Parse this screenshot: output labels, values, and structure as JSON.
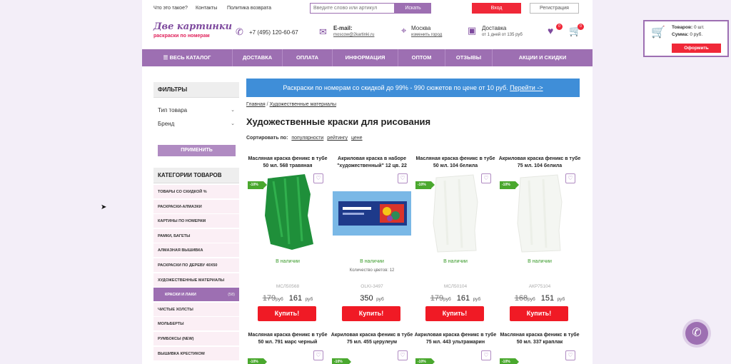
{
  "topbar": {
    "links": [
      "Что это такое?",
      "Контакты",
      "Политика возврата"
    ],
    "search_placeholder": "Введите слово или артикул",
    "search_button": "Искать",
    "login": "Вход",
    "register": "Регистрация"
  },
  "header": {
    "logo_title": "Две картинки",
    "logo_sub": "раскраски по номерам",
    "phone": "+7 (495) 120-60-67",
    "email_label": "E-mail:",
    "email": "moscow@2kartinki.ru",
    "city": "Москва",
    "city_change": "изменить город",
    "delivery_label": "Доставка",
    "delivery_text": "от 1 дней от 135 руб",
    "wishlist_count": "0",
    "cart_count": "0"
  },
  "nav": [
    "ВЕСЬ КАТАЛОГ",
    "ДОСТАВКА",
    "ОПЛАТА",
    "ИНФОРМАЦИЯ",
    "ОПТОМ",
    "ОТЗЫВЫ",
    "АКЦИИ И СКИДКИ"
  ],
  "sidebar": {
    "filters_title": "ФИЛЬТРЫ",
    "filters": [
      "Тип товара",
      "Бренд"
    ],
    "apply": "ПРИМЕНИТЬ",
    "categories_title": "КАТЕГОРИИ ТОВАРОВ",
    "categories": [
      {
        "label": "ТОВАРЫ СО СКИДКОЙ %"
      },
      {
        "label": "РАСКРАСКИ-АЛМАЗКИ"
      },
      {
        "label": "КАРТИНЫ ПО НОМЕРАМ"
      },
      {
        "label": "РАМКИ, БАГЕТЫ"
      },
      {
        "label": "АЛМАЗНАЯ ВЫШИВКА"
      },
      {
        "label": "РАСКРАСКИ ПО ДЕРЕВУ 40Х50"
      },
      {
        "label": "ХУДОЖЕСТВЕННЫЕ МАТЕРИАЛЫ"
      },
      {
        "label": "КРАСКИ И ЛАКИ",
        "count": "(58)",
        "active": true
      },
      {
        "label": "ЧИСТЫЕ ХОЛСТЫ"
      },
      {
        "label": "МОЛЬБЕРТЫ"
      },
      {
        "label": "РУМБОКСЫ (NEW)"
      },
      {
        "label": "ВЫШИВКА КРЕСТИКОМ"
      }
    ]
  },
  "main": {
    "banner_text": "Раскраски по номерам со скидкой до 99% - 990 сюжетов по цене от 10 руб.",
    "banner_link": "Перейти ->",
    "crumb_home": "Главная",
    "crumb_sep": "/",
    "crumb_section": "Художественные материалы",
    "title": "Художественные краски для рисования",
    "sort_label": "Сортировать по:",
    "sort_options": [
      "популярности",
      "рейтингу",
      "цене"
    ]
  },
  "products": [
    {
      "name": "Масляная краска феникс в тубе 50 мл. 568 травяная",
      "discount": "-10%",
      "avail": "В наличии",
      "sku": "МСЛ50568",
      "old": "179",
      "price": "161",
      "cur": "руб",
      "buy": "Купить!",
      "img": "green"
    },
    {
      "name": "Акриловая краска в наборе \"художественный\" 12 цв. 22",
      "discount": "",
      "avail": "В наличии",
      "colors": "Количество цветов: 12",
      "sku": "OLKI-3497",
      "old": "",
      "price": "350",
      "cur": "руб",
      "buy": "Купить!",
      "img": "box"
    },
    {
      "name": "Масляная краска феникс в тубе 50 мл. 104 белила",
      "discount": "-10%",
      "avail": "В наличии",
      "sku": "МСЛ50104",
      "old": "179",
      "price": "161",
      "cur": "руб",
      "buy": "Купить!",
      "img": "white"
    },
    {
      "name": "Акриловая краска феникс в тубе 75 мл. 104 белила",
      "discount": "-10%",
      "avail": "В наличии",
      "sku": "АКР75104",
      "old": "168",
      "price": "151",
      "cur": "руб",
      "buy": "Купить!",
      "img": "white"
    }
  ],
  "products_row2": [
    {
      "name": "Масляная краска феникс в тубе 50 мл. 791 марс черный",
      "discount": "-10%"
    },
    {
      "name": "Акриловая краска феникс в тубе 75 мл. 455 церулеум",
      "discount": "-10%"
    },
    {
      "name": "Акриловая краска феникс в тубе 75 мл. 443 ультрамарин",
      "discount": "-10%"
    },
    {
      "name": "Масляная краска феникс в тубе 50 мл. 337 краплак",
      "discount": "-10%"
    }
  ],
  "cart_widget": {
    "items_label": "Товаров:",
    "items_value": "0 шт.",
    "sum_label": "Сумма:",
    "sum_value": "0 руб.",
    "order": "Оформить"
  },
  "colors": {
    "brand": "#9d6fb2",
    "accent": "#f02838",
    "banner": "#3f8ed8",
    "instock": "#3a9a2a"
  },
  "icons": [
    "phone-icon",
    "mail-icon",
    "location-icon",
    "delivery-box-icon",
    "heart-icon",
    "cart-icon",
    "hamburger-icon",
    "chevron-down-icon",
    "phone-call-icon"
  ]
}
